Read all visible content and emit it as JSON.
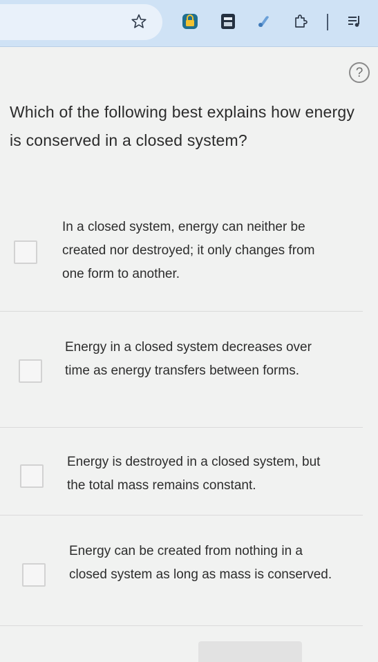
{
  "browser": {
    "toolbar_icons": [
      "star-icon",
      "lock-extension-icon",
      "printer-extension-icon",
      "pen-extension-icon",
      "extensions-puzzle-icon",
      "reading-list-icon"
    ],
    "accent_color": "#cfe2f5"
  },
  "help": {
    "label": "?"
  },
  "question": {
    "text": "Which of the following best explains how energy is conserved in a closed system?"
  },
  "options": [
    {
      "label": "In a closed system, energy can neither be created nor destroyed; it only changes from one form to another.",
      "selected": false
    },
    {
      "label": "Energy in a closed system decreases over time as energy transfers between forms.",
      "selected": false
    },
    {
      "label": "Energy is destroyed in a closed system, but the total mass remains constant.",
      "selected": false
    },
    {
      "label": "Energy can be created from nothing in a closed system as long as mass is conserved.",
      "selected": false
    }
  ]
}
